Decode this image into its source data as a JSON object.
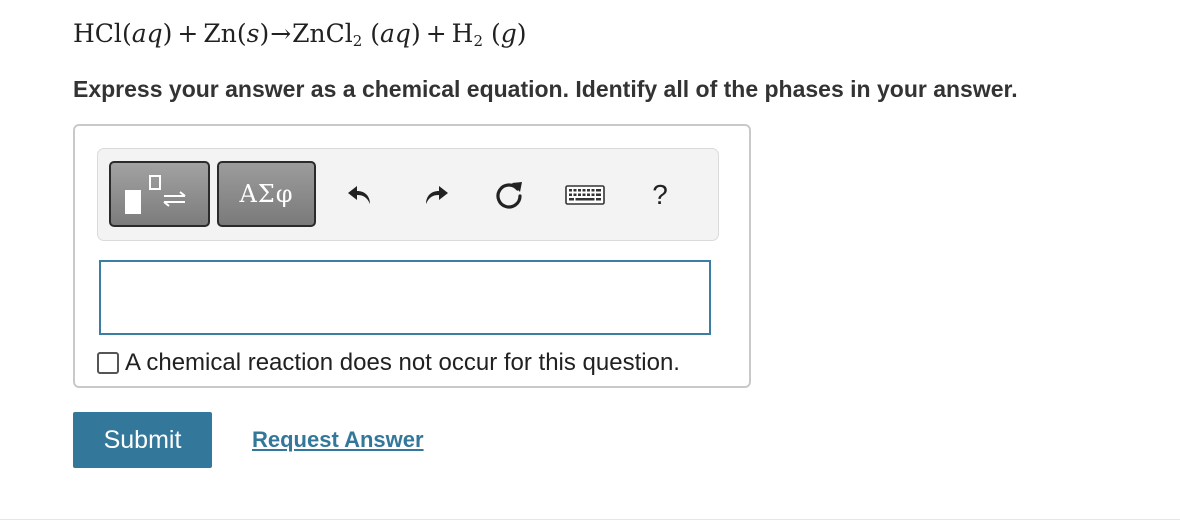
{
  "question": {
    "equation": {
      "reactant1": "HCl",
      "reactant1_phase": "aq",
      "plus1": "+",
      "reactant2": "Zn",
      "reactant2_phase": "s",
      "arrow": "→",
      "product1_main": "ZnCl",
      "product1_sub": "2",
      "product1_phase": "aq",
      "plus2": "+",
      "product2_main": "H",
      "product2_sub": "2",
      "product2_phase": "g"
    },
    "instruction": "Express your answer as a chemical equation. Identify all of the phases in your answer."
  },
  "toolbar": {
    "templates_icon": "templates-icon",
    "symbols_label": "ΑΣφ",
    "undo_icon": "undo-icon",
    "redo_icon": "redo-icon",
    "reset_icon": "reset-icon",
    "keyboard_icon": "keyboard-icon",
    "help_label": "?"
  },
  "answer": {
    "value": ""
  },
  "no_reaction": {
    "checked": false,
    "label": "A chemical reaction does not occur for this question."
  },
  "actions": {
    "submit_label": "Submit",
    "request_answer_label": "Request Answer"
  },
  "colors": {
    "accent": "#33779b",
    "input_border": "#3a7ea1",
    "text": "#212121"
  }
}
